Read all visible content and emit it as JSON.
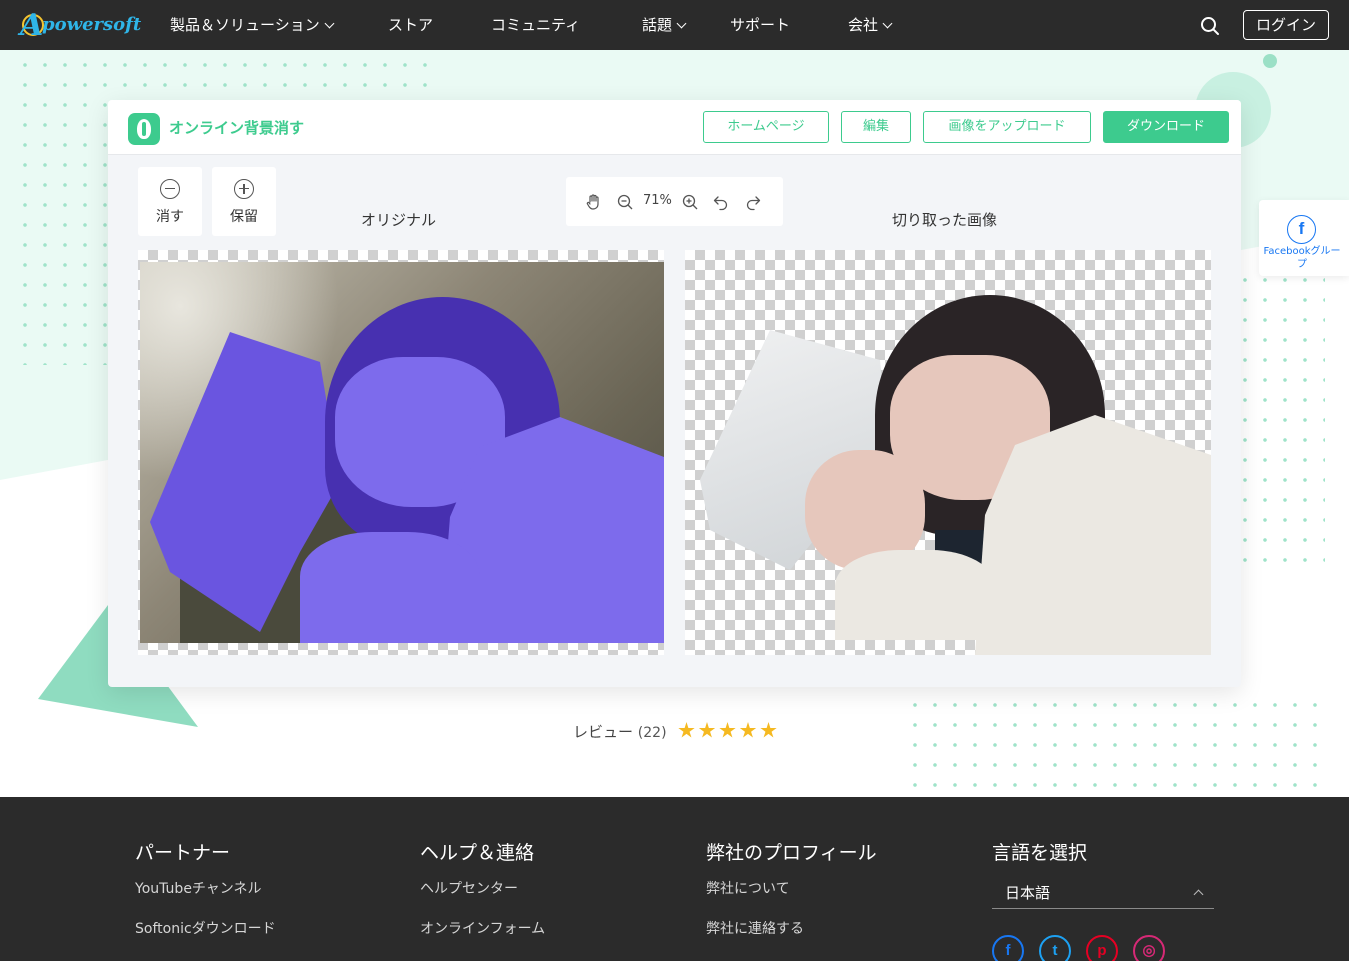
{
  "nav": {
    "logo_text": "powersoft",
    "items": [
      {
        "label": "製品＆ソリューション",
        "has_dropdown": true
      },
      {
        "label": "ストア",
        "has_dropdown": false
      },
      {
        "label": "コミュニティ",
        "has_dropdown": false
      },
      {
        "label": "話題",
        "has_dropdown": true
      },
      {
        "label": "サポート",
        "has_dropdown": false
      },
      {
        "label": "会社",
        "has_dropdown": true
      }
    ],
    "search_icon": "search-icon",
    "login_label": "ログイン"
  },
  "editor": {
    "app_title": "オンライン背景消す",
    "buttons": {
      "home": "ホームページ",
      "edit": "編集",
      "upload": "画像をアップロード",
      "download": "ダウンロード"
    },
    "tools": {
      "erase": "消す",
      "keep": "保留"
    },
    "zoom": {
      "value": "71%",
      "icons": [
        "hand-icon",
        "zoom-out-icon",
        "zoom-in-icon",
        "undo-icon",
        "redo-icon"
      ]
    },
    "labels": {
      "original": "オリジナル",
      "cutout": "切り取った画像"
    }
  },
  "review": {
    "label": "レビュー",
    "count": "(22)",
    "rating": 5,
    "star_color": "#f5b921"
  },
  "side_tab": {
    "icon": "facebook-icon",
    "label": "Facebookグループ"
  },
  "footer": {
    "columns": [
      {
        "heading": "パートナー",
        "links": [
          "YouTubeチャンネル",
          "Softonicダウンロード"
        ]
      },
      {
        "heading": "ヘルプ＆連絡",
        "links": [
          "ヘルプセンター",
          "オンラインフォーム"
        ]
      },
      {
        "heading": "弊社のプロフィール",
        "links": [
          "弊社について",
          "弊社に連絡する"
        ]
      },
      {
        "heading": "言語を選択",
        "links": []
      }
    ],
    "language_value": "日本語",
    "social_icons": [
      "facebook-icon",
      "twitter-icon",
      "pinterest-icon",
      "instagram-icon"
    ]
  },
  "colors": {
    "accent": "#3dcb8e",
    "nav_bg": "#2b2b2b",
    "footer_bg": "#2b2b2b",
    "hero_mint": "#eafaf4",
    "mask_purple": "#7d6bec"
  }
}
